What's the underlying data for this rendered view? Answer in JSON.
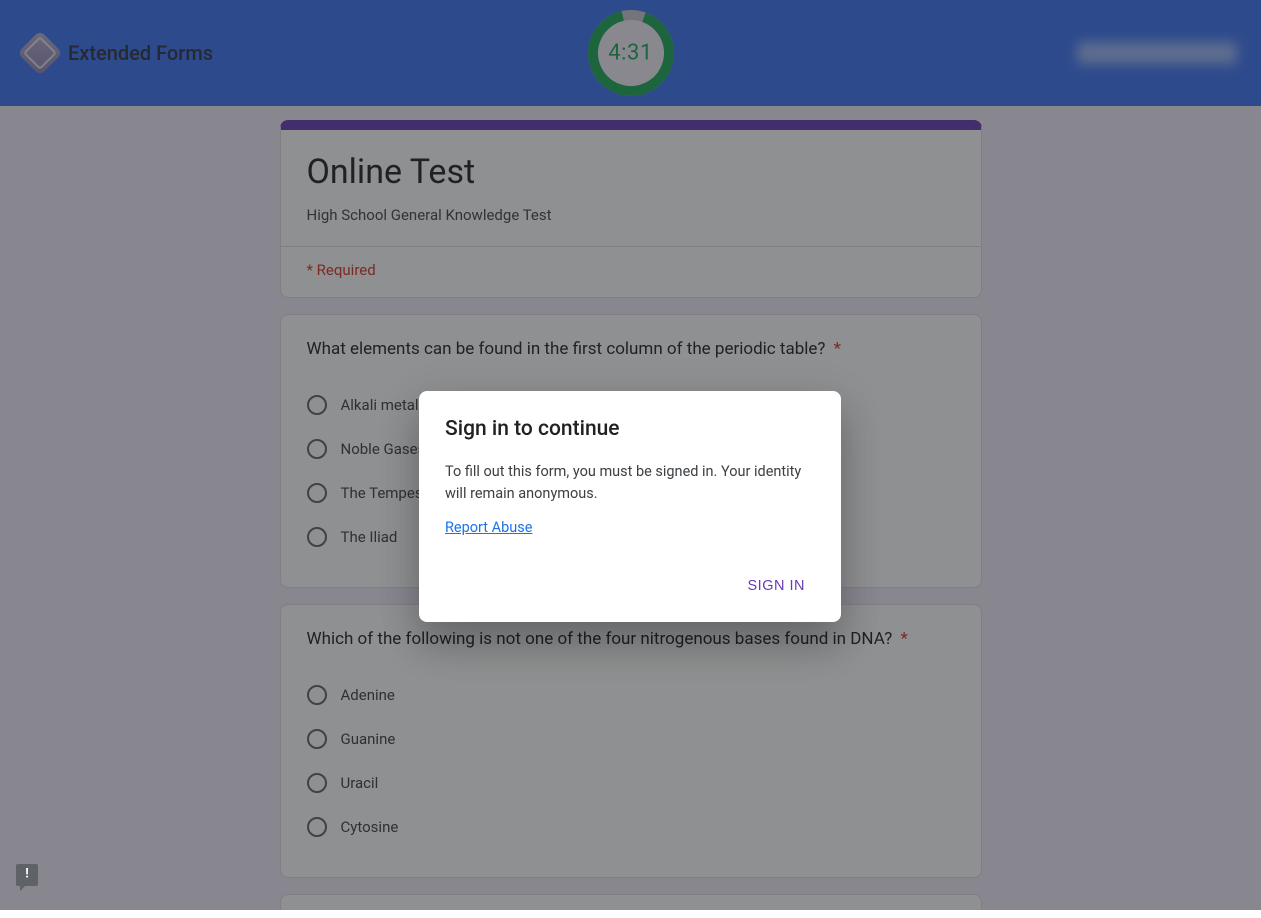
{
  "brand": {
    "name": "Extended Forms"
  },
  "timer": {
    "display": "4:31"
  },
  "form": {
    "title": "Online Test",
    "description": "High School General Knowledge Test",
    "required_text": "* Required"
  },
  "questions": [
    {
      "text": "What elements can be found in the first column of the periodic table?",
      "required": true,
      "options": [
        "Alkali metals",
        "Noble Gases",
        "The Tempest",
        "The Iliad"
      ]
    },
    {
      "text": "Which of the following is not one of the four nitrogenous bases found in DNA?",
      "required": true,
      "options": [
        "Adenine",
        "Guanine",
        "Uracil",
        "Cytosine"
      ]
    }
  ],
  "modal": {
    "title": "Sign in to continue",
    "message": "To fill out this form, you must be signed in. Your identity will remain anonymous.",
    "report_link": "Report Abuse",
    "signin_label": "SIGN IN"
  },
  "asterisk": "*"
}
